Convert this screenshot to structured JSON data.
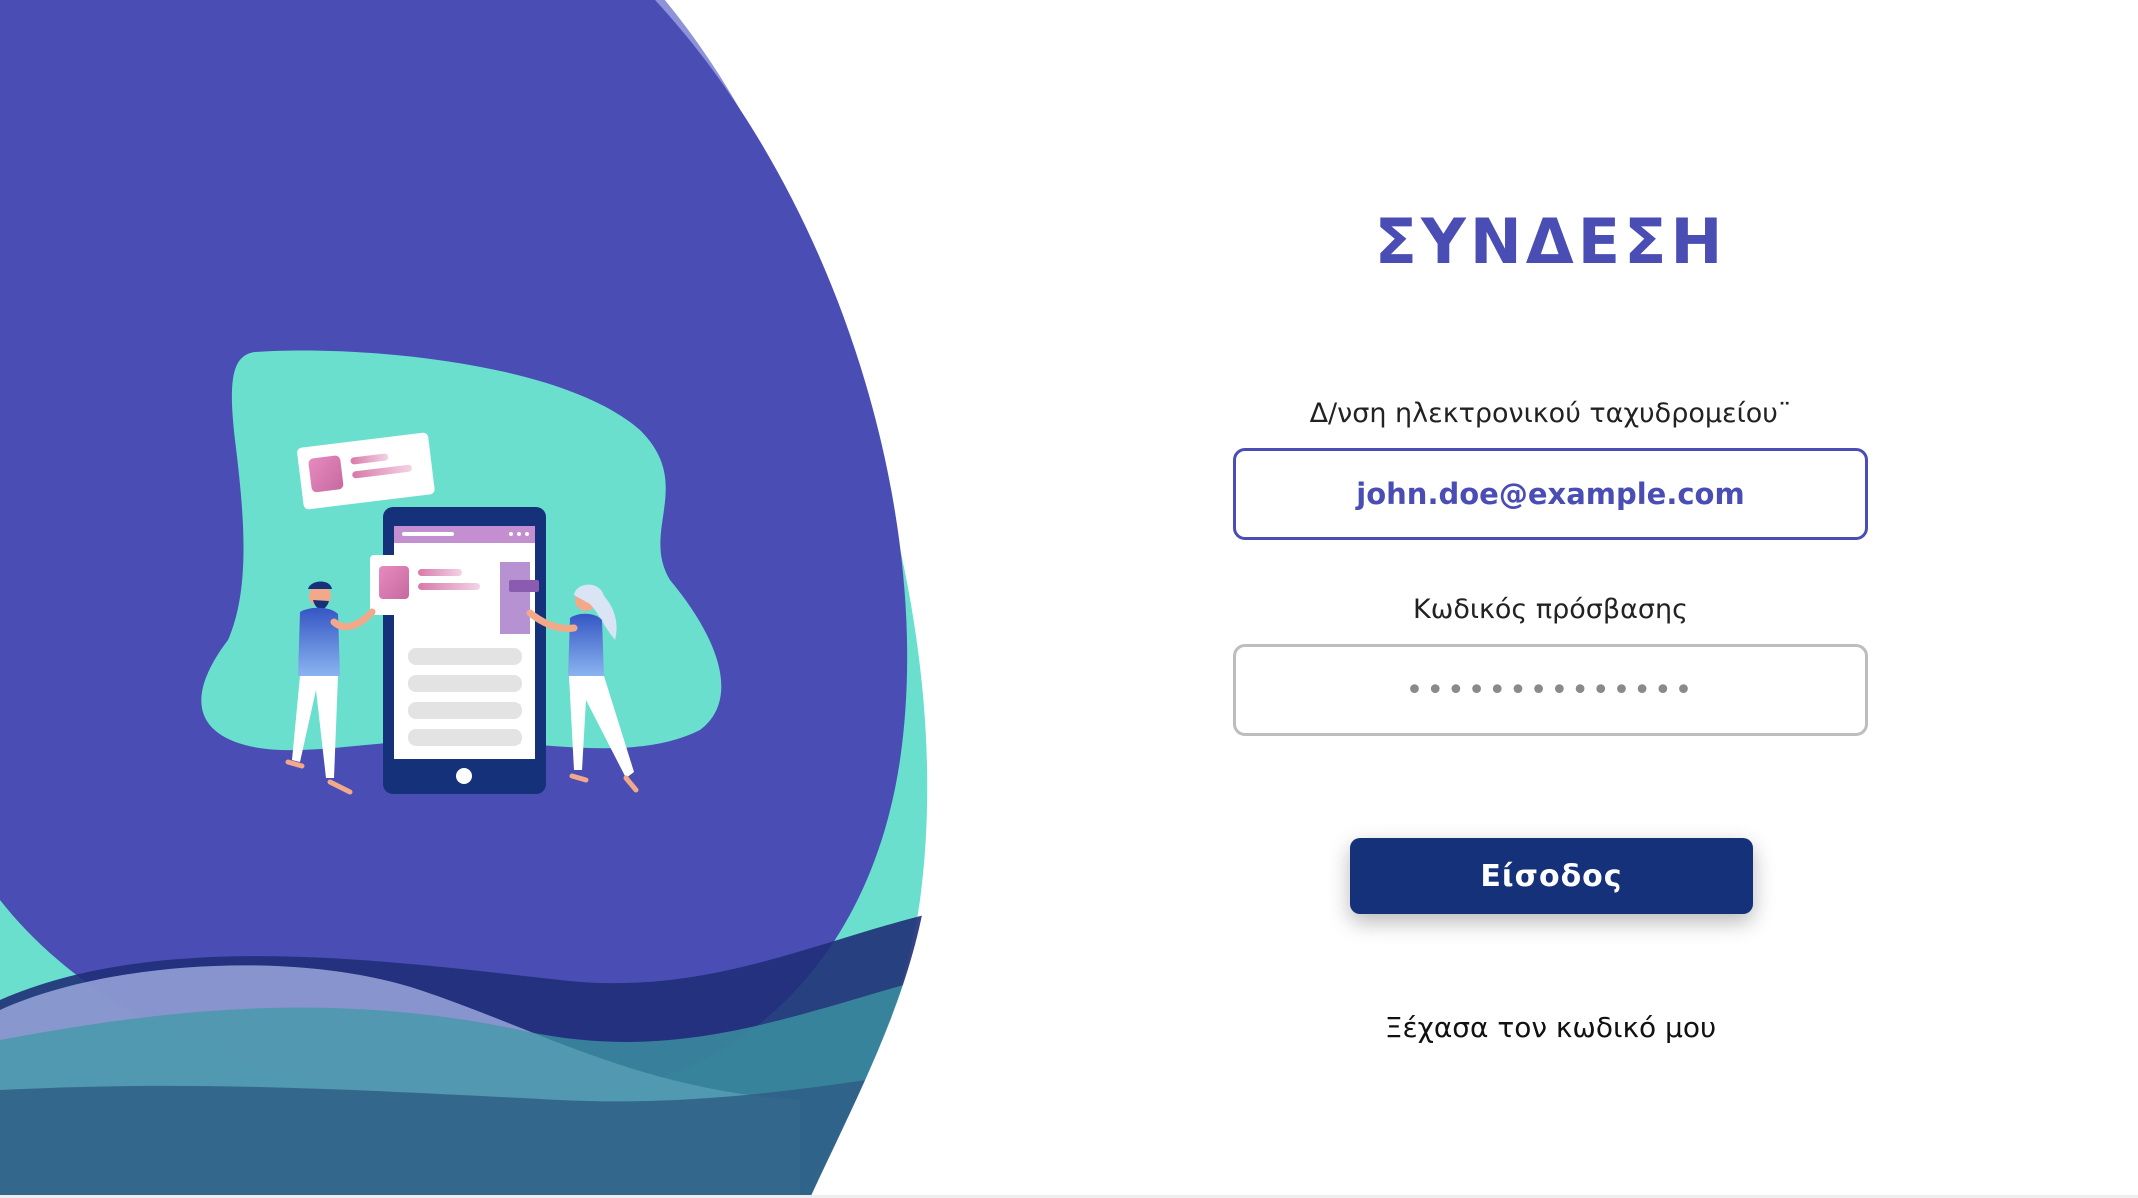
{
  "colors": {
    "primary": "#4a4eb4",
    "accent_teal": "#6adfcd",
    "button_navy": "#15317a"
  },
  "login": {
    "title": "ΣΥΝΔΕΣΗ",
    "email_label": "Δ/νση ηλεκτρονικού ταχυδρομείου¨",
    "email_value": "john.doe@example.com",
    "password_label": "Κωδικός πρόσβασης",
    "password_value": "••••••••••••••",
    "submit_label": "Είσοδος",
    "forgot_label": "Ξέχασα τον κωδικό μου"
  },
  "illustration": {
    "icon": "mobile-app-people-illustration"
  }
}
